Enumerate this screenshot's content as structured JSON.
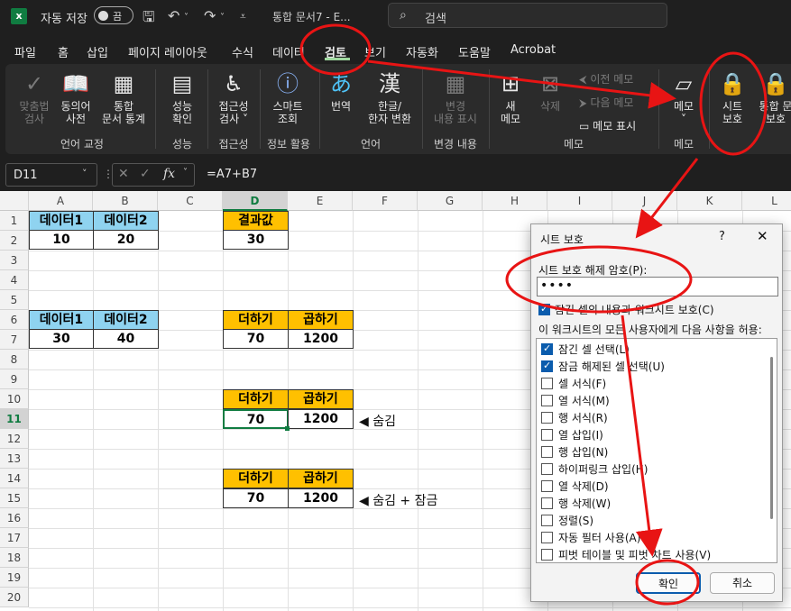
{
  "titlebar": {
    "logo": "x",
    "autosave_label": "자동 저장",
    "autosave_state": "끔",
    "doc_title": "통합 문서7 - E...",
    "search_placeholder": "검색"
  },
  "menu": {
    "tabs": [
      "파일",
      "홈",
      "삽입",
      "페이지 레이아웃",
      "수식",
      "데이터",
      "검토",
      "보기",
      "자동화",
      "도움말",
      "Acrobat"
    ],
    "active": "검토"
  },
  "ribbon": {
    "groups": [
      {
        "label": "언어 교정",
        "buttons": [
          "맞춤법\n검사",
          "동의어\n사전",
          "통합\n문서 통계"
        ]
      },
      {
        "label": "성능",
        "buttons": [
          "성능\n확인"
        ]
      },
      {
        "label": "접근성",
        "buttons": [
          "접근성\n검사 ˅"
        ]
      },
      {
        "label": "정보 활용",
        "buttons": [
          "스마트\n조회"
        ]
      },
      {
        "label": "언어",
        "buttons": [
          "번역",
          "한글/\n한자 변환"
        ]
      },
      {
        "label": "변경 내용",
        "buttons": [
          "변경\n내용 표시"
        ]
      },
      {
        "label": "메모",
        "buttons": [
          "새\n메모",
          "삭제"
        ],
        "small": [
          "이전 메모",
          "다음 메모",
          "메모 표시"
        ]
      },
      {
        "label": "메모",
        "buttons": [
          "메모\n˅"
        ]
      },
      {
        "label": "",
        "buttons": [
          "시트\n보호",
          "통합 문\n보호"
        ]
      }
    ]
  },
  "formula_bar": {
    "name_box": "D11",
    "fx": "fx",
    "formula": "=A7+B7"
  },
  "grid": {
    "columns": [
      "A",
      "B",
      "C",
      "D",
      "E",
      "F",
      "G",
      "H",
      "I",
      "J",
      "K",
      "L"
    ],
    "rows": [
      "1",
      "2",
      "3",
      "4",
      "5",
      "6",
      "7",
      "8",
      "9",
      "10",
      "11",
      "12",
      "13",
      "14",
      "15",
      "16",
      "17",
      "18",
      "19",
      "20"
    ],
    "cells": {
      "A1": "데이터1",
      "B1": "데이터2",
      "A2": "10",
      "B2": "20",
      "D1": "결과값",
      "D2": "30",
      "A6": "데이터1",
      "B6": "데이터2",
      "A7": "30",
      "B7": "40",
      "D6": "더하기",
      "E6": "곱하기",
      "D7": "70",
      "E7": "1200",
      "D10": "더하기",
      "E10": "곱하기",
      "D11": "70",
      "E11": "1200",
      "D14": "더하기",
      "E14": "곱하기",
      "D15": "70",
      "E15": "1200"
    },
    "notes": {
      "row11": "◀ 숨김",
      "row15": "◀ 숨김 + 잠금"
    }
  },
  "dialog": {
    "title": "시트 보호",
    "help": "?",
    "close": "✕",
    "password_label": "시트 보호 해제 암호(P):",
    "password_value": "••••",
    "protect_label": "잠긴 셀의 내용과 워크시트 보호(C)",
    "allow_label": "이 워크시트의 모든 사용자에게 다음 사항을 허용:",
    "options": [
      {
        "label": "잠긴 셀 선택(L)",
        "checked": true
      },
      {
        "label": "잠금 해제된 셀 선택(U)",
        "checked": true
      },
      {
        "label": "셀 서식(F)",
        "checked": false
      },
      {
        "label": "열 서식(M)",
        "checked": false
      },
      {
        "label": "행 서식(R)",
        "checked": false
      },
      {
        "label": "열 삽입(I)",
        "checked": false
      },
      {
        "label": "행 삽입(N)",
        "checked": false
      },
      {
        "label": "하이퍼링크 삽입(H)",
        "checked": false
      },
      {
        "label": "열 삭제(D)",
        "checked": false
      },
      {
        "label": "행 삭제(W)",
        "checked": false
      },
      {
        "label": "정렬(S)",
        "checked": false
      },
      {
        "label": "자동 필터 사용(A)",
        "checked": false
      },
      {
        "label": "피벗 테이블 및 피벗 차트 사용(V)",
        "checked": false
      }
    ],
    "ok": "확인",
    "cancel": "취소"
  },
  "colors": {
    "accent": "#107c41",
    "annotation": "#e81414",
    "header_blue": "#8fd3f0",
    "header_orange": "#ffc000"
  }
}
